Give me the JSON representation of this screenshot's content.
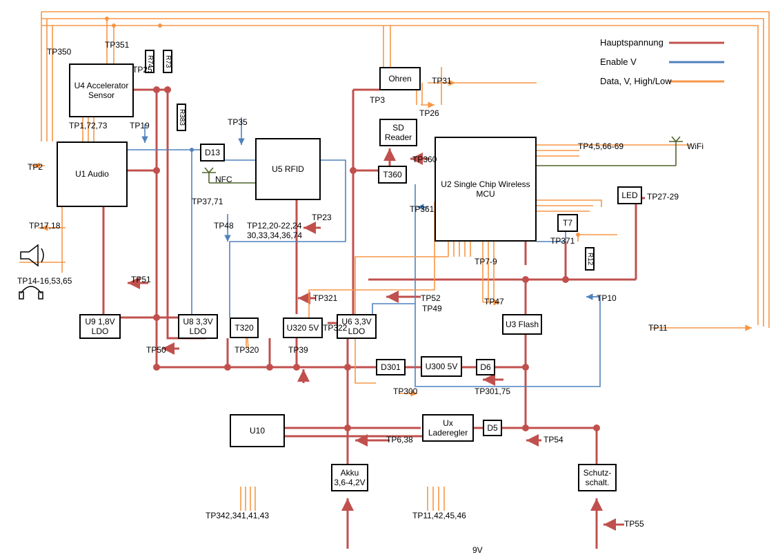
{
  "legend": {
    "hauptspannung": "Hauptspannung",
    "enable": "Enable V",
    "data": "Data, V, High/Low"
  },
  "blocks": {
    "u4": "U4\nAccelerator\nSensor",
    "u1": "U1 Audio",
    "d13": "D13",
    "u5": "U5 RFID",
    "ohren": "Ohren",
    "sd": "SD\nReader",
    "t360": "T360",
    "u2": "U2 Single Chip\nWireless MCU",
    "led": "LED",
    "t7": "T7",
    "u9": "U9 1,8V\nLDO",
    "u8": "U8 3,3V\nLDO",
    "t320": "T320",
    "u320": "U320 5V",
    "u6": "U6 3,3V\nLDO",
    "u3": "U3 Flash",
    "d301": "D301",
    "u300": "U300 5V",
    "d6": "D6",
    "u10": "U10",
    "ux": "Ux\nLaderegler",
    "d5": "D5",
    "akku": "Akku\n3,6-4,2V",
    "schutz": "Schutz-\nschalt.",
    "r74": "R74",
    "r73": "R73",
    "r383": "R383",
    "r12": "R12"
  },
  "tp": {
    "tp350": "TP350",
    "tp351": "TP351",
    "tp25": "TP25",
    "tp172": "TP1,72,73",
    "tp19": "TP19",
    "tp35": "TP35",
    "tp2": "TP2",
    "tp37": "TP37,71",
    "tp48": "TP48",
    "tp1220": "TP12,20-22,24\n30,33,34,36,74",
    "tp23": "TP23",
    "tp1718": "TP17,18",
    "tp1416": "TP14-16,53,65",
    "tp51": "TP51",
    "tp50": "TP50",
    "tp320": "TP320",
    "tp322": "TP322",
    "tp39": "TP39",
    "tp321": "TP321",
    "tp52": "TP52",
    "tp49": "TP49",
    "tp47": "TP47",
    "tp10": "TP10",
    "tp11": "TP11",
    "tp79": "TP7-9",
    "tp300": "TP300",
    "tp301": "TP301,75",
    "tp638": "TP6,38",
    "tp342": "TP342,341,41,43",
    "tp1142": "TP11,42,45,46",
    "tp54": "TP54",
    "tp55": "TP55",
    "tp31": "TP31",
    "tp3": "TP3",
    "tp26": "TP26",
    "tp360": "TP360",
    "tp361": "TP361",
    "tp371": "TP371",
    "tp27": "TP27-29",
    "tp4566": "TP4,5,66-69",
    "nfc": "NFC",
    "wifi": "WiFi",
    "v9": "9V"
  }
}
